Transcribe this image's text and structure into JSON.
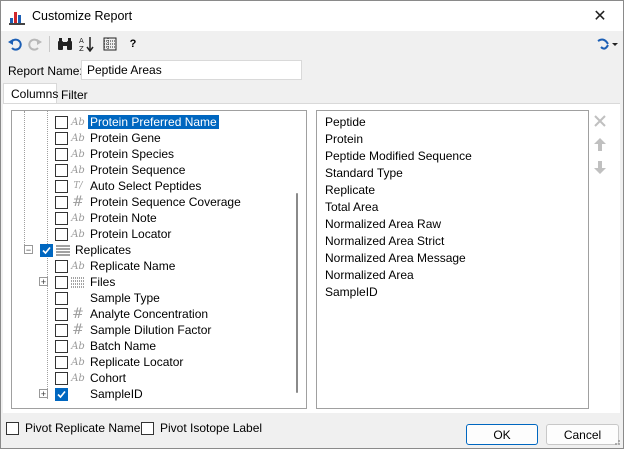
{
  "window": {
    "title": "Customize Report"
  },
  "toolbar": {
    "undo_icon": "undo-icon",
    "redo_icon": "redo-icon",
    "find_icon": "binoculars-icon",
    "sort_icon": "sort-az-icon",
    "preview_icon": "table-preview-icon",
    "help_label": "?",
    "dropdown_icon": "share-icon"
  },
  "report_name": {
    "label": "Report Name:",
    "value": "Peptide Areas"
  },
  "tabs": [
    {
      "label": "Columns"
    },
    {
      "label": "Filter"
    }
  ],
  "tree": {
    "rows": [
      {
        "label": "Protein Preferred Name",
        "icon": "text-icon",
        "glyph": "Ab",
        "checked": false,
        "selected": true
      },
      {
        "label": "Protein Gene",
        "icon": "text-icon",
        "glyph": "Ab",
        "checked": false
      },
      {
        "label": "Protein Species",
        "icon": "text-icon",
        "glyph": "Ab",
        "checked": false
      },
      {
        "label": "Protein Sequence",
        "icon": "text-icon",
        "glyph": "Ab",
        "checked": false
      },
      {
        "label": "Auto Select Peptides",
        "icon": "boolean-icon",
        "glyph": "T/F",
        "checked": false
      },
      {
        "label": "Protein Sequence Coverage",
        "icon": "number-icon",
        "glyph": "#",
        "checked": false
      },
      {
        "label": "Protein Note",
        "icon": "text-icon",
        "glyph": "Ab",
        "checked": false
      },
      {
        "label": "Protein Locator",
        "icon": "text-icon",
        "glyph": "Ab",
        "checked": false
      },
      {
        "label": "Replicates",
        "icon": "list-icon",
        "glyph": "",
        "checked": true
      },
      {
        "label": "Replicate Name",
        "icon": "text-icon",
        "glyph": "Ab",
        "checked": false
      },
      {
        "label": "Files",
        "icon": "list-icon",
        "glyph": "",
        "checked": false
      },
      {
        "label": "Sample Type",
        "icon": "none",
        "glyph": "",
        "checked": false
      },
      {
        "label": "Analyte Concentration",
        "icon": "number-icon",
        "glyph": "#",
        "checked": false
      },
      {
        "label": "Sample Dilution Factor",
        "icon": "number-icon",
        "glyph": "#",
        "checked": false
      },
      {
        "label": "Batch Name",
        "icon": "text-icon",
        "glyph": "Ab",
        "checked": false
      },
      {
        "label": "Replicate Locator",
        "icon": "text-icon",
        "glyph": "Ab",
        "checked": false
      },
      {
        "label": "Cohort",
        "icon": "text-icon",
        "glyph": "Ab",
        "checked": false
      },
      {
        "label": "SampleID",
        "icon": "none",
        "glyph": "",
        "checked": true
      }
    ]
  },
  "columns_list": [
    "Peptide",
    "Protein",
    "Peptide Modified Sequence",
    "Standard Type",
    "Replicate",
    "Total Area",
    "Normalized Area Raw",
    "Normalized Area Strict",
    "Normalized Area Message",
    "Normalized Area",
    "SampleID"
  ],
  "side_buttons": {
    "delete_icon": "delete-icon",
    "up_icon": "move-up-icon",
    "down_icon": "move-down-icon"
  },
  "bottom": {
    "pivot_replicate": "Pivot Replicate Name",
    "pivot_isotope": "Pivot Isotope Label",
    "ok": "OK",
    "cancel": "Cancel"
  },
  "colors": {
    "accent": "#0067c0",
    "selection": "#0067c0"
  }
}
